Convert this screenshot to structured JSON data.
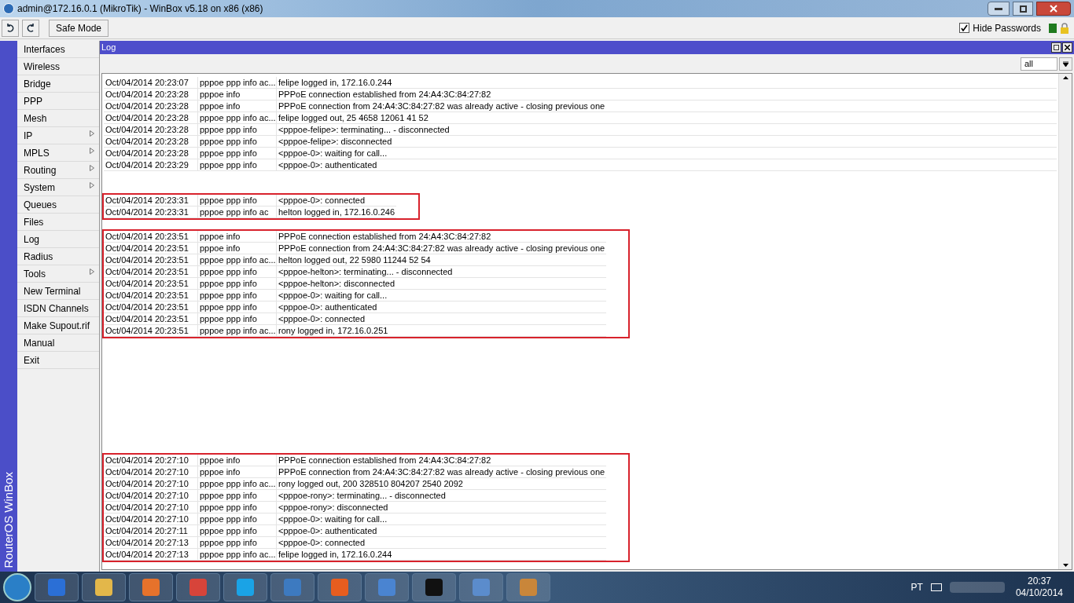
{
  "window": {
    "title": "admin@172.16.0.1 (MikroTik) - WinBox v5.18 on x86 (x86)"
  },
  "toolbar": {
    "safe_mode": "Safe Mode",
    "hide_passwords": {
      "label": "Hide Passwords",
      "checked": true
    }
  },
  "sidebar": {
    "brand": "RouterOS WinBox",
    "items": [
      {
        "label": "Interfaces",
        "submenu": false
      },
      {
        "label": "Wireless",
        "submenu": false
      },
      {
        "label": "Bridge",
        "submenu": false
      },
      {
        "label": "PPP",
        "submenu": false
      },
      {
        "label": "Mesh",
        "submenu": false
      },
      {
        "label": "IP",
        "submenu": true
      },
      {
        "label": "MPLS",
        "submenu": true
      },
      {
        "label": "Routing",
        "submenu": true
      },
      {
        "label": "System",
        "submenu": true
      },
      {
        "label": "Queues",
        "submenu": false
      },
      {
        "label": "Files",
        "submenu": false
      },
      {
        "label": "Log",
        "submenu": false
      },
      {
        "label": "Radius",
        "submenu": false
      },
      {
        "label": "Tools",
        "submenu": true
      },
      {
        "label": "New Terminal",
        "submenu": false
      },
      {
        "label": "ISDN Channels",
        "submenu": false
      },
      {
        "label": "Make Supout.rif",
        "submenu": false
      },
      {
        "label": "Manual",
        "submenu": false
      },
      {
        "label": "Exit",
        "submenu": false
      }
    ]
  },
  "log": {
    "title": "Log",
    "filter": "all",
    "groups": [
      {
        "highlighted": false,
        "rows": [
          [
            "Oct/04/2014 20:23:07",
            "pppoe ppp info ac...",
            "felipe logged in, 172.16.0.244"
          ],
          [
            "Oct/04/2014 20:23:28",
            "pppoe info",
            "PPPoE connection established from 24:A4:3C:84:27:82"
          ],
          [
            "Oct/04/2014 20:23:28",
            "pppoe info",
            "PPPoE connection from 24:A4:3C:84:27:82 was already active - closing previous one"
          ],
          [
            "Oct/04/2014 20:23:28",
            "pppoe ppp info ac...",
            "felipe logged out, 25 4658 12061 41 52"
          ],
          [
            "Oct/04/2014 20:23:28",
            "pppoe ppp info",
            "<pppoe-felipe>: terminating... - disconnected"
          ],
          [
            "Oct/04/2014 20:23:28",
            "pppoe ppp info",
            "<pppoe-felipe>: disconnected"
          ],
          [
            "Oct/04/2014 20:23:28",
            "pppoe ppp info",
            "<pppoe-0>: waiting for call..."
          ],
          [
            "Oct/04/2014 20:23:29",
            "pppoe ppp info",
            "<pppoe-0>: authenticated"
          ]
        ]
      },
      {
        "highlighted": true,
        "rows": [
          [
            "Oct/04/2014 20:23:31",
            "pppoe ppp info",
            "<pppoe-0>: connected"
          ],
          [
            "Oct/04/2014 20:23:31",
            "pppoe ppp info ac",
            "helton logged in, 172.16.0.246"
          ]
        ]
      },
      {
        "highlighted": true,
        "rows": [
          [
            "Oct/04/2014 20:23:51",
            "pppoe info",
            "PPPoE connection established from 24:A4:3C:84:27:82"
          ],
          [
            "Oct/04/2014 20:23:51",
            "pppoe info",
            "PPPoE connection from 24:A4:3C:84:27:82 was already active - closing previous one"
          ],
          [
            "Oct/04/2014 20:23:51",
            "pppoe ppp info ac...",
            "helton logged out, 22 5980 11244 52 54"
          ],
          [
            "Oct/04/2014 20:23:51",
            "pppoe ppp info",
            "<pppoe-helton>: terminating... - disconnected"
          ],
          [
            "Oct/04/2014 20:23:51",
            "pppoe ppp info",
            "<pppoe-helton>: disconnected"
          ],
          [
            "Oct/04/2014 20:23:51",
            "pppoe ppp info",
            "<pppoe-0>: waiting for call..."
          ],
          [
            "Oct/04/2014 20:23:51",
            "pppoe ppp info",
            "<pppoe-0>: authenticated"
          ],
          [
            "Oct/04/2014 20:23:51",
            "pppoe ppp info",
            "<pppoe-0>: connected"
          ],
          [
            "Oct/04/2014 20:23:51",
            "pppoe ppp info ac...",
            "rony logged in, 172.16.0.251"
          ]
        ]
      },
      {
        "highlighted": true,
        "rows": [
          [
            "Oct/04/2014 20:27:10",
            "pppoe info",
            "PPPoE connection established from 24:A4:3C:84:27:82"
          ],
          [
            "Oct/04/2014 20:27:10",
            "pppoe info",
            "PPPoE connection from 24:A4:3C:84:27:82 was already active - closing previous one"
          ],
          [
            "Oct/04/2014 20:27:10",
            "pppoe ppp info ac...",
            "rony logged out, 200 328510 804207 2540 2092"
          ],
          [
            "Oct/04/2014 20:27:10",
            "pppoe ppp info",
            "<pppoe-rony>: terminating... - disconnected"
          ],
          [
            "Oct/04/2014 20:27:10",
            "pppoe ppp info",
            "<pppoe-rony>: disconnected"
          ],
          [
            "Oct/04/2014 20:27:10",
            "pppoe ppp info",
            "<pppoe-0>: waiting for call..."
          ],
          [
            "Oct/04/2014 20:27:11",
            "pppoe ppp info",
            "<pppoe-0>: authenticated"
          ],
          [
            "Oct/04/2014 20:27:13",
            "pppoe ppp info",
            "<pppoe-0>: connected"
          ],
          [
            "Oct/04/2014 20:27:13",
            "pppoe ppp info ac...",
            "felipe logged in, 172.16.0.244"
          ]
        ]
      }
    ]
  },
  "taskbar": {
    "language": "PT",
    "time": "20:37",
    "date": "04/10/2014"
  }
}
